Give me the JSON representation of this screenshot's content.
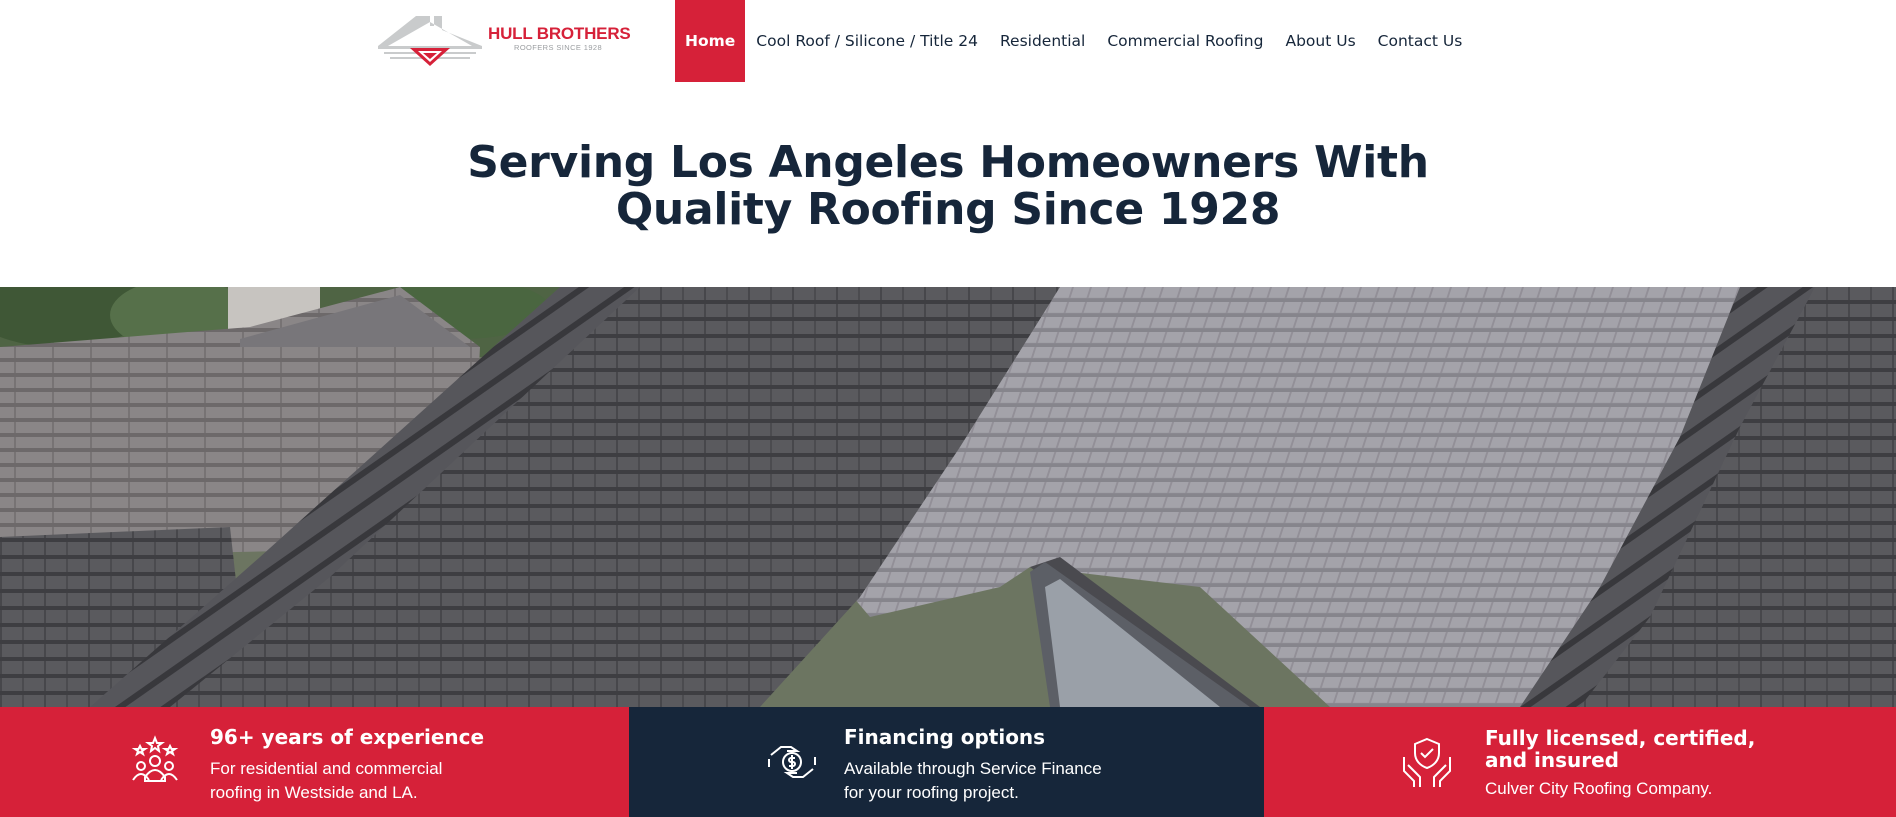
{
  "brand": {
    "name": "HULL BROTHERS",
    "tagline": "ROOFERS SINCE 1928",
    "primary_color": "#d62139",
    "navy_color": "#16263a",
    "logo_icon": "house-roof-logo-icon"
  },
  "nav": {
    "items": [
      {
        "label": "Home",
        "active": true
      },
      {
        "label": "Cool Roof / Silicone / Title 24",
        "active": false
      },
      {
        "label": "Residential",
        "active": false
      },
      {
        "label": "Commercial Roofing",
        "active": false
      },
      {
        "label": "About Us",
        "active": false
      },
      {
        "label": "Contact Us",
        "active": false
      }
    ]
  },
  "hero": {
    "title_line1": "Serving Los Angeles Homeowners With",
    "title_line2": "Quality Roofing Since 1928",
    "image": "gray asphalt shingle roof photo"
  },
  "features": [
    {
      "icon": "people-stars-icon",
      "title": "96+ years of experience",
      "text_line1": "For residential and commercial",
      "text_line2": "roofing in Westside and LA.",
      "background": "#d62139"
    },
    {
      "icon": "hand-dollar-coin-icon",
      "title": "Financing options",
      "text_line1": "Available through Service Finance",
      "text_line2": "for your roofing project.",
      "background": "#16263a"
    },
    {
      "icon": "hands-shield-check-icon",
      "title_line1": "Fully licensed, certified,",
      "title_line2": "and insured",
      "text_line1": "Culver City Roofing Company.",
      "background": "#d62139"
    }
  ]
}
